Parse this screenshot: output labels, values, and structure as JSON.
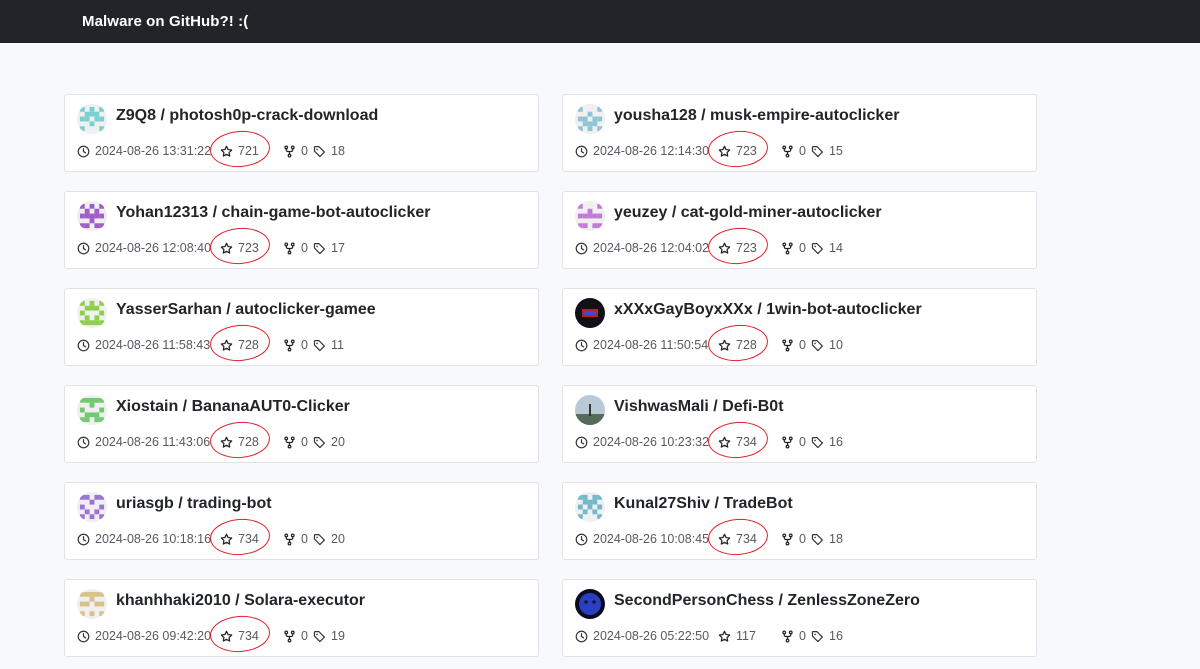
{
  "navbar": {
    "brand": "Malware on GitHub?! :("
  },
  "repos": [
    {
      "owner": "Z9Q8",
      "name": "photosh0p-crack-download",
      "full": "Z9Q8 / photosh0p-crack-download",
      "time": "2024-08-26 13:31:22",
      "stars": "721",
      "forks": "0",
      "tags": "18",
      "avatar_color": "#79d0d0",
      "circled": true
    },
    {
      "owner": "yousha128",
      "name": "musk-empire-autoclicker",
      "full": "yousha128 / musk-empire-autoclicker",
      "time": "2024-08-26 12:14:30",
      "stars": "723",
      "forks": "0",
      "tags": "15",
      "avatar_color": "#8fc5d6",
      "circled": true
    },
    {
      "owner": "Yohan12313",
      "name": "chain-game-bot-autoclicker",
      "full": "Yohan12313 / chain-game-bot-autoclicker",
      "time": "2024-08-26 12:08:40",
      "stars": "723",
      "forks": "0",
      "tags": "17",
      "avatar_color": "#a05dc8",
      "circled": true
    },
    {
      "owner": "yeuzey",
      "name": "cat-gold-miner-autoclicker",
      "full": "yeuzey / cat-gold-miner-autoclicker",
      "time": "2024-08-26 12:04:02",
      "stars": "723",
      "forks": "0",
      "tags": "14",
      "avatar_color": "#c07ad8",
      "circled": true
    },
    {
      "owner": "YasserSarhan",
      "name": "autoclicker-gamee",
      "full": "YasserSarhan / autoclicker-gamee",
      "time": "2024-08-26 11:58:43",
      "stars": "728",
      "forks": "0",
      "tags": "11",
      "avatar_color": "#8fd04a",
      "circled": true
    },
    {
      "owner": "xXXxGayBoyxXXx",
      "name": "1win-bot-autoclicker",
      "full": "xXXxGayBoyxXXx / 1win-bot-autoclicker",
      "time": "2024-08-26 11:50:54",
      "stars": "728",
      "forks": "0",
      "tags": "10",
      "avatar_color": "#101010",
      "circled": true
    },
    {
      "owner": "Xiostain",
      "name": "BananaAUT0-Clicker",
      "full": "Xiostain / BananaAUT0-Clicker",
      "time": "2024-08-26 11:43:06",
      "stars": "728",
      "forks": "0",
      "tags": "20",
      "avatar_color": "#6fca6f",
      "circled": true
    },
    {
      "owner": "VishwasMali",
      "name": "Defi-B0t",
      "full": "VishwasMali / Defi-B0t",
      "time": "2024-08-26 10:23:32",
      "stars": "734",
      "forks": "0",
      "tags": "16",
      "avatar_color": "#7a9ab0",
      "circled": true
    },
    {
      "owner": "uriasgb",
      "name": "trading-bot",
      "full": "uriasgb / trading-bot",
      "time": "2024-08-26 10:18:16",
      "stars": "734",
      "forks": "0",
      "tags": "20",
      "avatar_color": "#9a72d8",
      "circled": true
    },
    {
      "owner": "Kunal27Shiv",
      "name": "TradeBot",
      "full": "Kunal27Shiv / TradeBot",
      "time": "2024-08-26 10:08:45",
      "stars": "734",
      "forks": "0",
      "tags": "18",
      "avatar_color": "#74b8cc",
      "circled": true
    },
    {
      "owner": "khanhhaki2010",
      "name": "Solara-executor",
      "full": "khanhhaki2010 / Solara-executor",
      "time": "2024-08-26 09:42:20",
      "stars": "734",
      "forks": "0",
      "tags": "19",
      "avatar_color": "#d8c28a",
      "circled": true
    },
    {
      "owner": "SecondPersonChess",
      "name": "ZenlessZoneZero",
      "full": "SecondPersonChess / ZenlessZoneZero",
      "time": "2024-08-26 05:22:50",
      "stars": "117",
      "forks": "0",
      "tags": "16",
      "avatar_color": "#2a3fc0",
      "circled": false
    }
  ],
  "icons": {
    "time": "clock-icon",
    "stars": "star-icon",
    "forks": "fork-icon",
    "tags": "tag-icon"
  },
  "colors": {
    "navbar": "#212529",
    "annotation": "#e0202a"
  }
}
